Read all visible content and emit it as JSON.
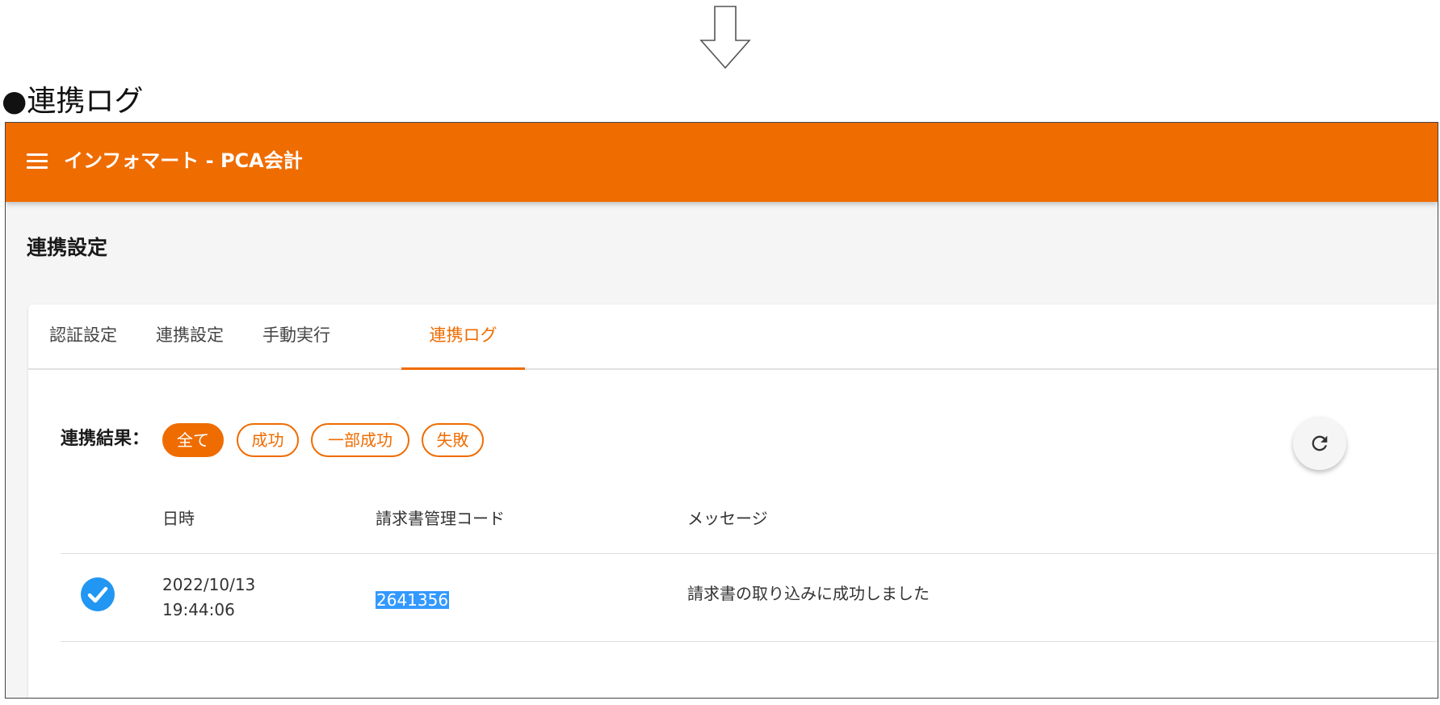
{
  "section_label": "●連携ログ",
  "app": {
    "title": "インフォマート - PCA会計",
    "accent_color": "#ef6c00"
  },
  "page_title": "連携設定",
  "tabs": [
    {
      "label": "認証設定",
      "active": false
    },
    {
      "label": "連携設定",
      "active": false
    },
    {
      "label": "手動実行",
      "active": false
    },
    {
      "label": "連携ログ",
      "active": true
    }
  ],
  "filter": {
    "label": "連携結果：",
    "options": [
      {
        "label": "全て",
        "selected": true
      },
      {
        "label": "成功",
        "selected": false
      },
      {
        "label": "一部成功",
        "selected": false
      },
      {
        "label": "失敗",
        "selected": false
      }
    ]
  },
  "refresh_icon": "refresh-icon",
  "table": {
    "headers": [
      "日時",
      "請求書管理コード",
      "メッセージ"
    ],
    "rows": [
      {
        "status_icon": "check-circle-icon",
        "status_color": "#2196f3",
        "date": "2022/10/13",
        "time": "19:44:06",
        "code": "2641356",
        "message": "請求書の取り込みに成功しました"
      }
    ]
  }
}
